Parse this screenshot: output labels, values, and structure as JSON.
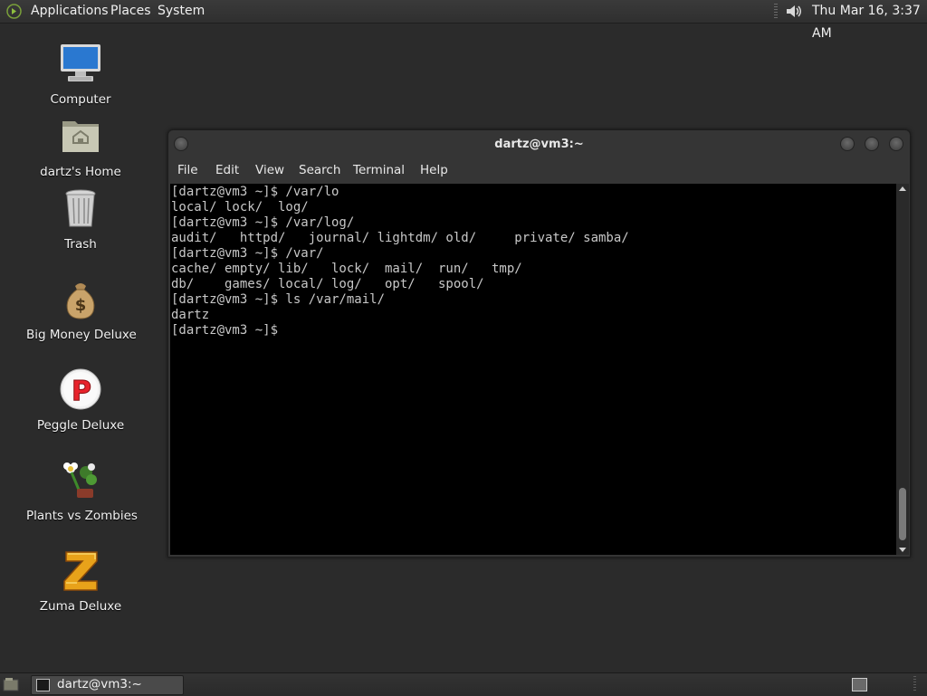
{
  "top_panel": {
    "menus": [
      "Applications",
      "Places",
      "System"
    ],
    "clock": "Thu Mar 16,  3:37 AM"
  },
  "desktop_icons": [
    {
      "label": "Computer",
      "icon": "computer-icon"
    },
    {
      "label": "dartz's Home",
      "icon": "home-folder-icon"
    },
    {
      "label": "Trash",
      "icon": "trash-icon"
    },
    {
      "label": "Big Money Deluxe",
      "icon": "money-bag-icon"
    },
    {
      "label": "Peggle Deluxe",
      "icon": "peggle-icon"
    },
    {
      "label": "Plants vs Zombies",
      "icon": "plants-zombies-icon"
    },
    {
      "label": "Zuma Deluxe",
      "icon": "zuma-icon"
    }
  ],
  "terminal": {
    "title": "dartz@vm3:~",
    "menu": [
      "File",
      "Edit",
      "View",
      "Search",
      "Terminal",
      "Help"
    ],
    "lines": [
      "[dartz@vm3 ~]$ /var/lo",
      "local/ lock/  log/",
      "[dartz@vm3 ~]$ /var/log/",
      "audit/   httpd/   journal/ lightdm/ old/     private/ samba/",
      "[dartz@vm3 ~]$ /var/",
      "cache/ empty/ lib/   lock/  mail/  run/   tmp/",
      "db/    games/ local/ log/   opt/   spool/",
      "[dartz@vm3 ~]$ ls /var/mail/",
      "dartz",
      "[dartz@vm3 ~]$ "
    ]
  },
  "bottom_panel": {
    "task_label": "dartz@vm3:~"
  }
}
